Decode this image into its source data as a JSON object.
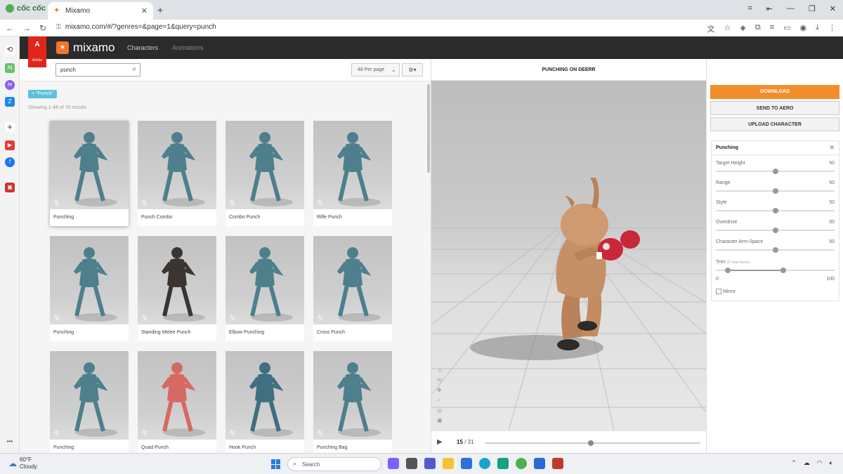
{
  "browser": {
    "brand": "cốc cốc",
    "tab_title": "Mixamo",
    "url": "mixamo.com/#/?genres=&page=1&query=punch"
  },
  "mixamo": {
    "adobe_label": "Adobe",
    "logo_text": "mixamo",
    "nav": [
      "Characters",
      "Animations"
    ]
  },
  "browse": {
    "search_value": "punch",
    "per_page": "48 Per page",
    "filter_chip": "× \"Punch\"",
    "results_text": "Showing 1-48 of 76 results",
    "cards": [
      {
        "label": "Punching",
        "color": "#4d7f8c"
      },
      {
        "label": "Punch Combo",
        "color": "#4d7f8c"
      },
      {
        "label": "Combo Punch",
        "color": "#4d7f8c"
      },
      {
        "label": "Rifle Punch",
        "color": "#4d7f8c"
      },
      {
        "label": "Punching",
        "color": "#4d7f8c"
      },
      {
        "label": "Standing Melee Punch",
        "color": "#3a3530"
      },
      {
        "label": "Elbow Punching",
        "color": "#4d7f8c"
      },
      {
        "label": "Cross Punch",
        "color": "#4d7f8c"
      },
      {
        "label": "Punching",
        "color": "#4d7f8c"
      },
      {
        "label": "Quad Punch",
        "color": "#d56a63"
      },
      {
        "label": "Hook Punch",
        "color": "#3f6f80"
      },
      {
        "label": "Punching Bag",
        "color": "#4d7f8c"
      }
    ]
  },
  "viewer": {
    "title": "PUNCHING ON DEERR",
    "current_frame": "15",
    "total_frames": "/ 31",
    "progress": 0.48
  },
  "panel": {
    "download": "DOWNLOAD",
    "send_aero": "SEND TO AERO",
    "upload": "UPLOAD CHARACTER",
    "params_title": "Punching",
    "params": [
      {
        "label": "Target Height",
        "value": "50",
        "fraction": 0.5
      },
      {
        "label": "Range",
        "value": "50",
        "fraction": 0.5
      },
      {
        "label": "Style",
        "value": "50",
        "fraction": 0.5
      },
      {
        "label": "Overdrive",
        "value": "50",
        "fraction": 0.5
      },
      {
        "label": "Character Arm-Space",
        "value": "50",
        "fraction": 0.5
      }
    ],
    "trim_label": "Trim",
    "trim_note": "32 total frames",
    "trim_min": "0",
    "trim_max": "100",
    "trim_start": 0.1,
    "trim_end": 0.57,
    "mirror_label": "Mirror"
  },
  "taskbar": {
    "temp": "60°F",
    "condition": "Cloudy",
    "search_placeholder": "Search"
  }
}
